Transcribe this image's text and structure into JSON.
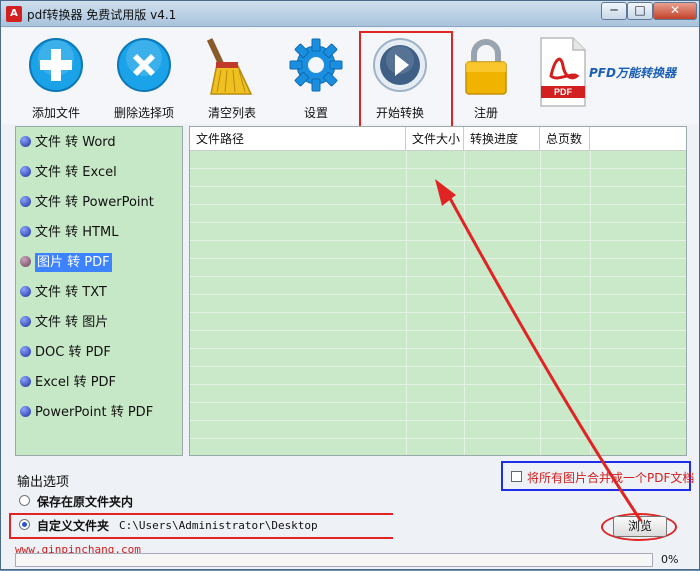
{
  "window": {
    "title": "pdf转换器 免费试用版 v4.1",
    "app_icon_glyph": "A",
    "controls": {
      "minimize": "─",
      "maximize": "□",
      "close": "✕"
    }
  },
  "toolbar": {
    "add": {
      "label": "添加文件",
      "icon": "plus-circle-icon",
      "color": "#1aa3e8"
    },
    "remove": {
      "label": "删除选择项",
      "icon": "x-circle-icon",
      "color": "#1aa3e8"
    },
    "clear": {
      "label": "清空列表",
      "icon": "broom-icon"
    },
    "settings": {
      "label": "设置",
      "icon": "gear-icon",
      "color": "#1a8fe0"
    },
    "start": {
      "label": "开始转换",
      "icon": "play-icon"
    },
    "register": {
      "label": "注册",
      "icon": "lock-icon",
      "color": "#f0b400"
    }
  },
  "brand": {
    "text": "PFD万能转换器",
    "pdf_label": "PDF"
  },
  "sidebar": {
    "items": [
      {
        "label": "文件 转 Word"
      },
      {
        "label": "文件 转 Excel"
      },
      {
        "label": "文件 转 PowerPoint"
      },
      {
        "label": "文件 转 HTML"
      },
      {
        "label": "图片 转 PDF"
      },
      {
        "label": "文件 转 TXT"
      },
      {
        "label": "文件 转 图片"
      },
      {
        "label": "DOC 转 PDF"
      },
      {
        "label": "Excel 转 PDF"
      },
      {
        "label": "PowerPoint 转 PDF"
      }
    ],
    "selected_index": 4
  },
  "table": {
    "columns": [
      "文件路径",
      "文件大小",
      "转换进度",
      "总页数"
    ],
    "rows": []
  },
  "output": {
    "section_label": "输出选项",
    "option_original": "保存在原文件夹内",
    "option_custom": "自定义文件夹",
    "selected": "custom",
    "path_value": "C:\\Users\\Administrator\\Desktop",
    "browse_label": "浏览",
    "merge_label": "将所有图片合并成一个PDF文档",
    "merge_checked": false
  },
  "watermark": "www.qinpinchang.com",
  "progress": {
    "value": 0,
    "text": "0%"
  },
  "annotation_colors": {
    "red": "#e02424",
    "blue": "#1e2ee8"
  }
}
